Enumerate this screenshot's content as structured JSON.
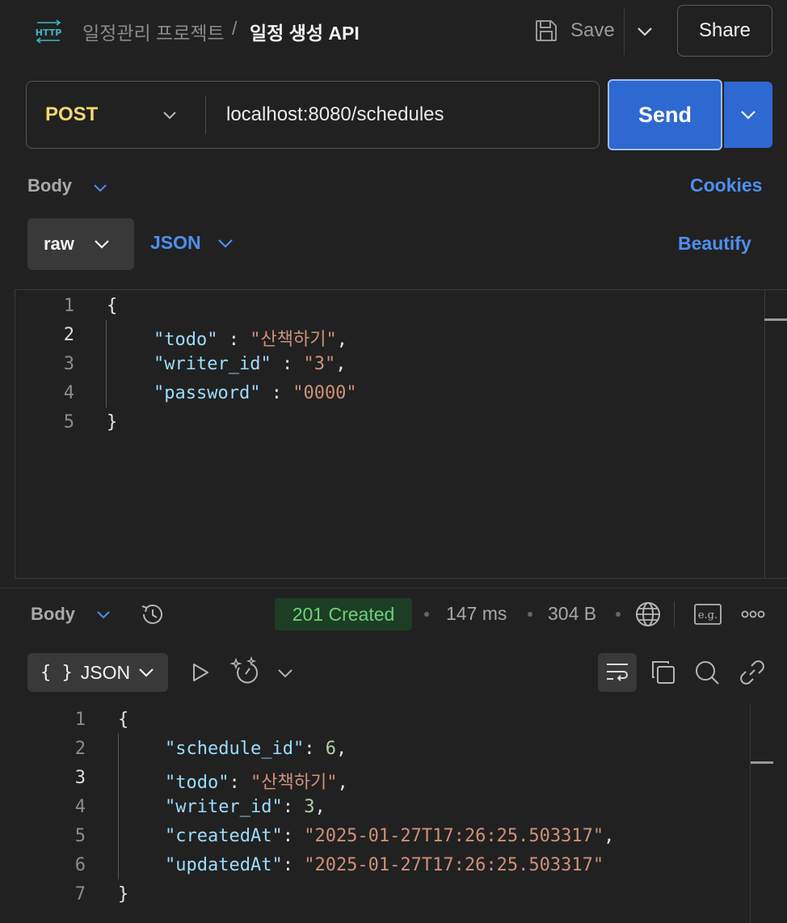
{
  "header": {
    "icon": "http-icon",
    "collection": "일정관리 프로젝트",
    "separator": "/",
    "request_name": "일정 생성 API",
    "save_label": "Save",
    "share_label": "Share"
  },
  "request": {
    "method": "POST",
    "url": "localhost:8080/schedules",
    "send_label": "Send",
    "method_color": "#f5d76e"
  },
  "request_body": {
    "tab_label": "Body",
    "cookies_label": "Cookies",
    "mode_label": "raw",
    "format_label": "JSON",
    "beautify_label": "Beautify",
    "line_numbers": [
      "1",
      "2",
      "3",
      "4",
      "5"
    ],
    "lines": {
      "open": "{",
      "todo_key": "\"todo\"",
      "todo_sep": " : ",
      "todo_val": "\"산책하기\"",
      "writer_key": "\"writer_id\"",
      "writer_sep": " : ",
      "writer_val": "\"3\"",
      "password_key": "\"password\"",
      "password_sep": " : ",
      "password_val": "\"0000\"",
      "comma": ",",
      "close": "}"
    }
  },
  "response": {
    "tab_label": "Body",
    "status": "201 Created",
    "time": "147 ms",
    "size": "304 B",
    "format_icon": "{ }",
    "format_label": "JSON",
    "eg_label": "e.g.",
    "line_numbers": [
      "1",
      "2",
      "3",
      "4",
      "5",
      "6",
      "7"
    ],
    "lines": {
      "open": "{",
      "schedule_id_key": "\"schedule_id\"",
      "schedule_id_val": "6",
      "todo_key": "\"todo\"",
      "todo_val": "\"산책하기\"",
      "writer_id_key": "\"writer_id\"",
      "writer_id_val": "3",
      "createdAt_key": "\"createdAt\"",
      "createdAt_val": "\"2025-01-27T17:26:25.503317\"",
      "updatedAt_key": "\"updatedAt\"",
      "updatedAt_val": "\"2025-01-27T17:26:25.503317\"",
      "colon": ": ",
      "comma": ",",
      "close": "}"
    },
    "status_color": "#6fd07a"
  },
  "colors": {
    "accent": "#2e68d1",
    "link": "#4d8ff0",
    "background": "#212121"
  }
}
